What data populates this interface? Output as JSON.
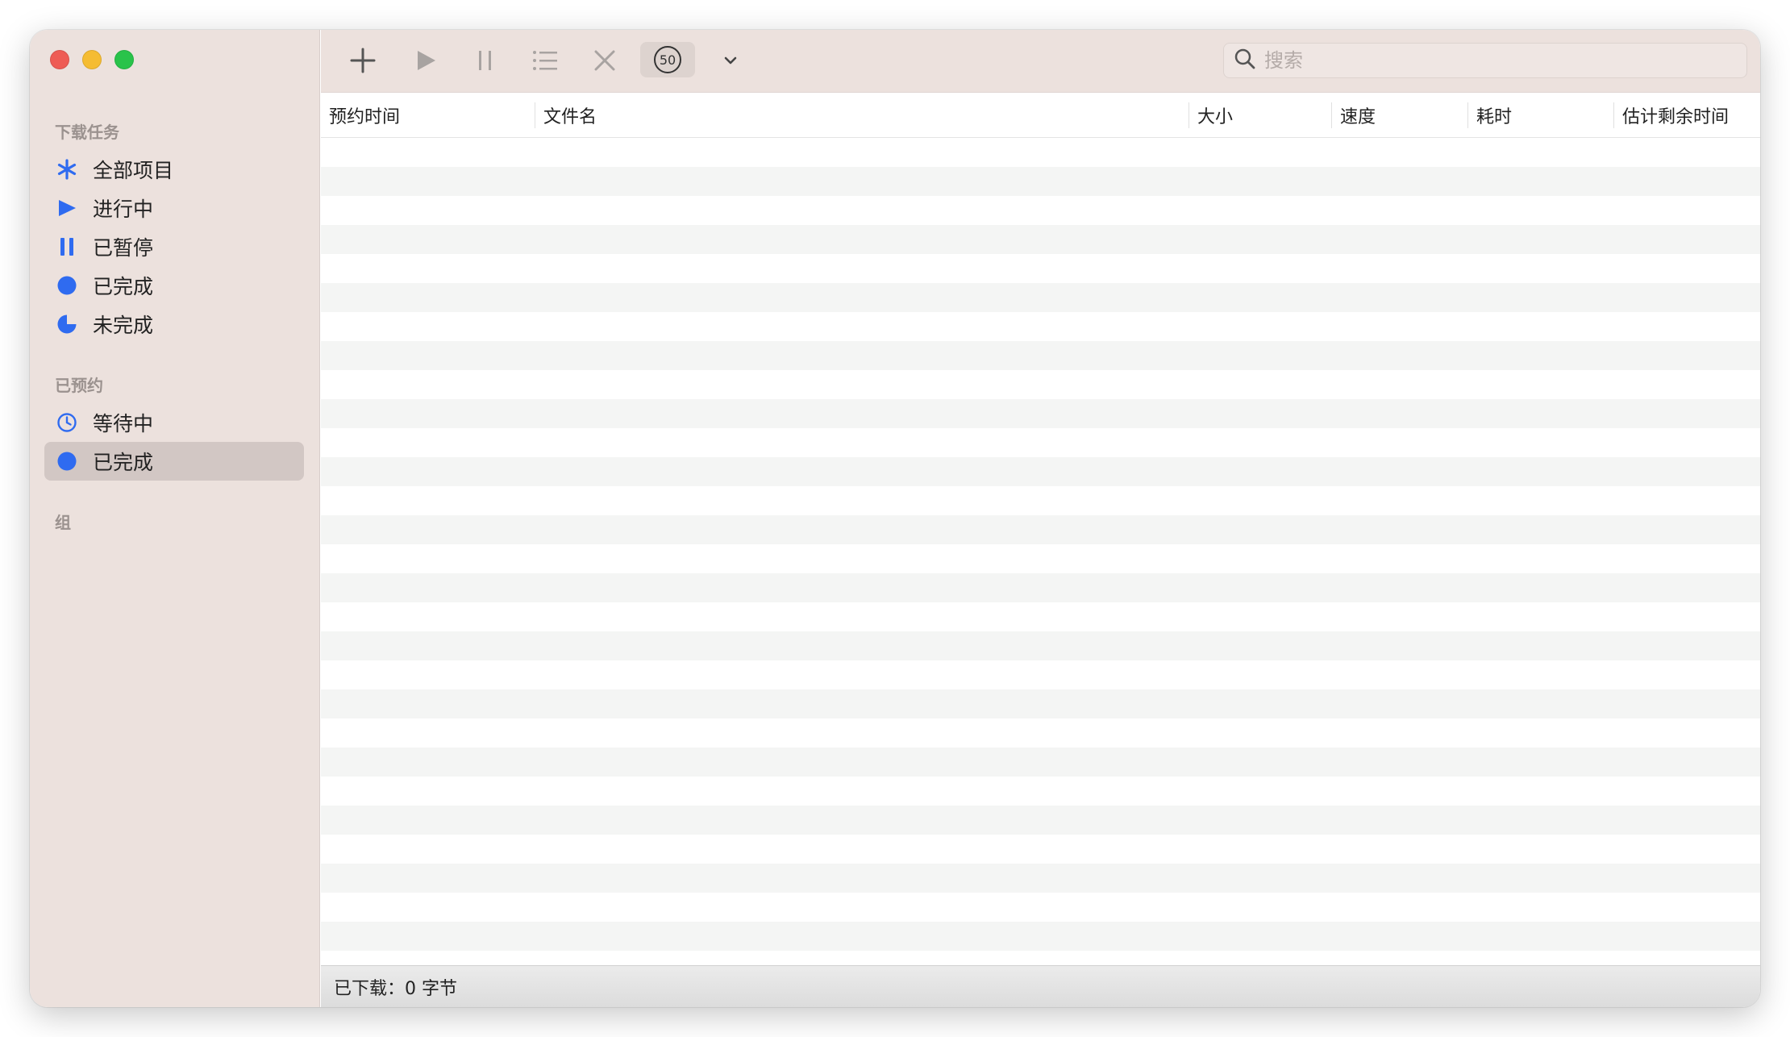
{
  "sidebar": {
    "sections": {
      "downloads": "下载任务",
      "scheduled": "已预约",
      "groups": "组"
    },
    "download_items": [
      {
        "label": "全部项目",
        "icon": "asterisk-icon"
      },
      {
        "label": "进行中",
        "icon": "play-icon"
      },
      {
        "label": "已暂停",
        "icon": "pause-icon"
      },
      {
        "label": "已完成",
        "icon": "filled-circle-icon"
      },
      {
        "label": "未完成",
        "icon": "moon-icon"
      }
    ],
    "scheduled_items": [
      {
        "label": "等待中",
        "icon": "clock-icon"
      },
      {
        "label": "已完成",
        "icon": "filled-circle-icon",
        "selected": true
      }
    ]
  },
  "toolbar": {
    "speed_limit": "50",
    "search_placeholder": "搜索"
  },
  "table": {
    "columns": [
      "预约时间",
      "文件名",
      "大小",
      "速度",
      "耗时",
      "估计剩余时间"
    ],
    "rows": []
  },
  "status": {
    "downloaded": "已下载：0 字节"
  },
  "colors": {
    "accent": "#2f6bf0",
    "sidebar_bg": "#ece1dd",
    "selected_bg": "#d2c7c4"
  }
}
